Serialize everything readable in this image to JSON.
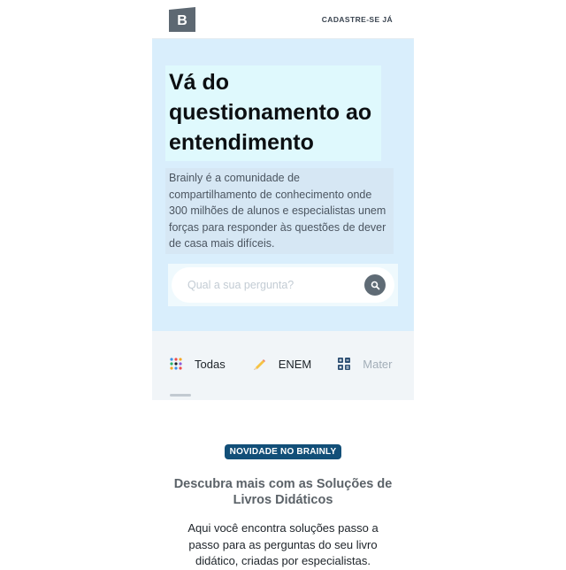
{
  "header": {
    "logo_text": "B",
    "signup_label": "CADASTRE-SE JÁ"
  },
  "hero": {
    "headline": "Vá do questionamento ao entendimento",
    "description": "Brainly é a comunidade de compartilhamento de conhecimento onde 300 milhões de alunos e especialistas unem forças para responder às questões de dever de casa mais difíceis.",
    "search_placeholder": "Qual a sua pergunta?"
  },
  "categories": [
    {
      "label": "Todas",
      "icon": "grid-dots-icon"
    },
    {
      "label": "ENEM",
      "icon": "pencil-icon"
    },
    {
      "label": "Mater",
      "icon": "squares-icon"
    }
  ],
  "promo": {
    "badge": "NOVIDADE NO BRAINLY",
    "title": "Descubra mais com as Soluções de Livros Didáticos",
    "text": "Aqui você encontra soluções passo a passo para as perguntas do seu livro didático, criadas por especialistas."
  },
  "colors": {
    "hero_bg": "#d9eefc",
    "badge_bg": "#124f78",
    "search_button": "#5f6b75"
  }
}
